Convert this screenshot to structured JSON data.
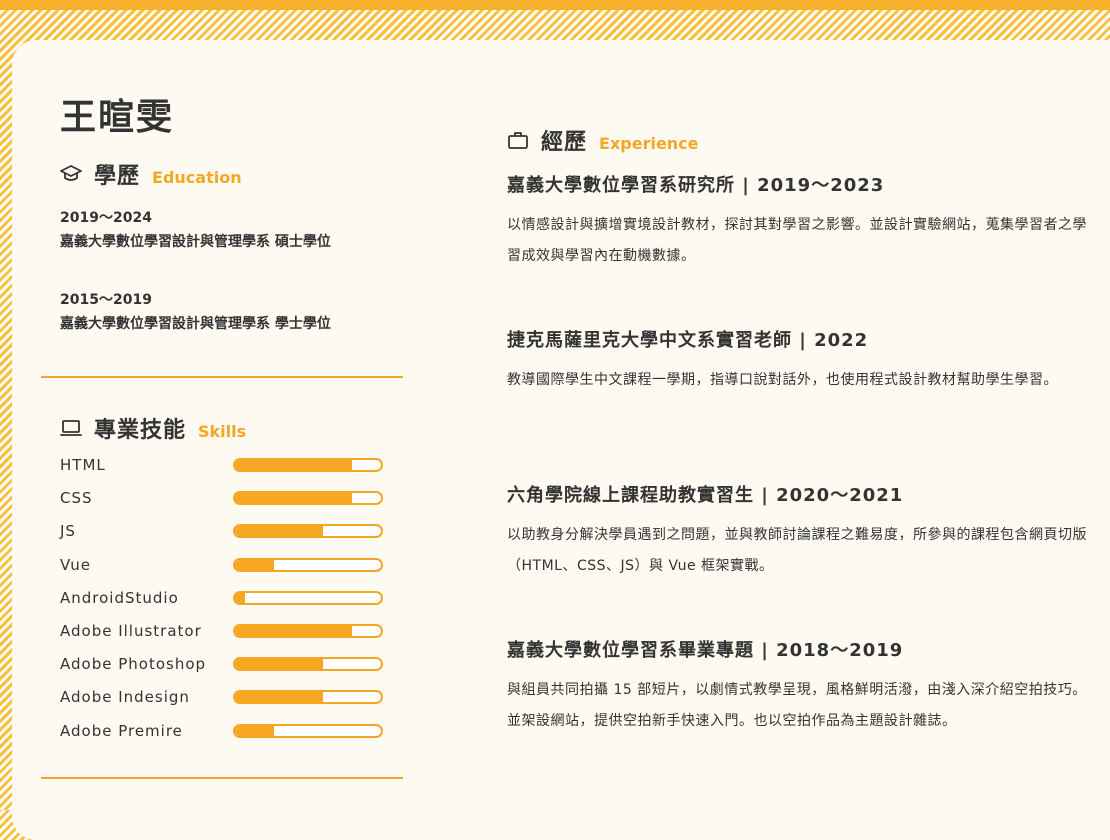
{
  "profile": {
    "name": "王暄雯"
  },
  "education": {
    "title": "學歷",
    "subtitle": "Education",
    "icon": "graduation-cap-icon",
    "items": [
      {
        "years": "2019～2024",
        "school": "嘉義大學數位學習設計與管理學系 碩士學位"
      },
      {
        "years": "2015～2019",
        "school": "嘉義大學數位學習設計與管理學系 學士學位"
      }
    ]
  },
  "skills": {
    "title": "專業技能",
    "subtitle": "Skills",
    "icon": "laptop-icon",
    "items": [
      {
        "name": "HTML",
        "level": 0.8
      },
      {
        "name": "CSS",
        "level": 0.8
      },
      {
        "name": "JS",
        "level": 0.6
      },
      {
        "name": "Vue",
        "level": 0.27
      },
      {
        "name": "AndroidStudio",
        "level": 0.07
      },
      {
        "name": "Adobe Illustrator",
        "level": 0.8
      },
      {
        "name": "Adobe Photoshop",
        "level": 0.6
      },
      {
        "name": "Adobe Indesign",
        "level": 0.6
      },
      {
        "name": "Adobe Premire",
        "level": 0.27
      }
    ]
  },
  "experience": {
    "title": "經歷",
    "subtitle": "Experience",
    "icon": "briefcase-icon",
    "items": [
      {
        "title": "嘉義大學數位學習系研究所 | 2019～2023",
        "description": "以情感設計與擴增實境設計教材，探討其對學習之影響。並設計實驗網站，蒐集學習者之學習成效與學習內在動機數據。"
      },
      {
        "title": "捷克馬薩里克大學中文系實習老師 | 2022",
        "description": "教導國際學生中文課程一學期，指導口說對話外，也使用程式設計教材幫助學生學習。"
      },
      {
        "title": "六角學院線上課程助教實習生 | 2020～2021",
        "description": "以助教身分解決學員遇到之問題，並與教師討論課程之難易度，所參與的課程包含網頁切版（HTML、CSS、JS）與 Vue 框架實戰。"
      },
      {
        "title": "嘉義大學數位學習系畢業專題 | 2018～2019",
        "description": "與組員共同拍攝 15 部短片，以劇情式教學呈現，風格鮮明活潑，由淺入深介紹空拍技巧。並架設網站，提供空拍新手快速入門。也以空拍作品為主題設計雜誌。"
      }
    ]
  },
  "colors": {
    "accent": "#f5a623",
    "background": "#fdfaf2",
    "text": "#333333"
  }
}
